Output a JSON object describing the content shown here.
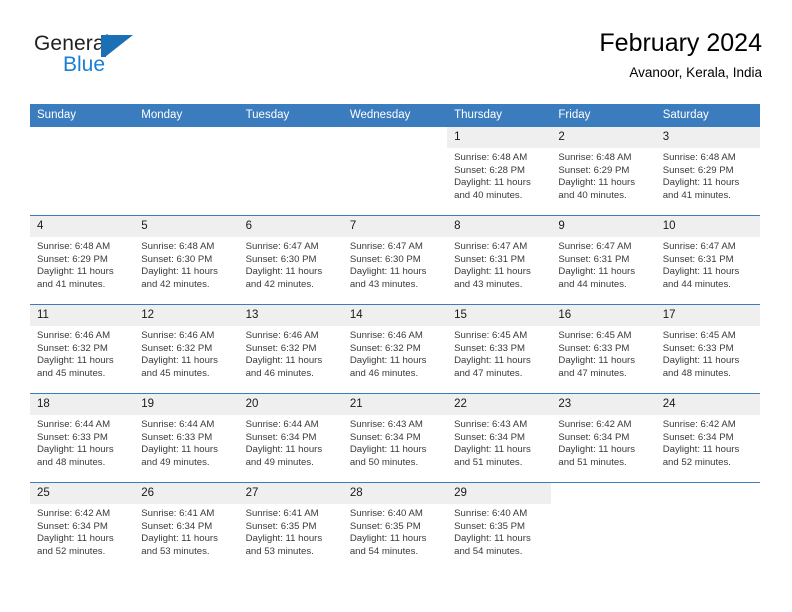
{
  "brand": {
    "name_top": "General",
    "name_bottom": "Blue",
    "mark": "triangle-logo"
  },
  "header": {
    "title": "February 2024",
    "subtitle": "Avanoor, Kerala, India"
  },
  "colors": {
    "header_blue": "#3a7cbe",
    "brand_blue": "#1a7fd4",
    "day_band": "#efefef"
  },
  "weekdays": [
    "Sunday",
    "Monday",
    "Tuesday",
    "Wednesday",
    "Thursday",
    "Friday",
    "Saturday"
  ],
  "weeks": [
    [
      {
        "day": "",
        "lines": [],
        "state": "blank"
      },
      {
        "day": "",
        "lines": [],
        "state": "blank"
      },
      {
        "day": "",
        "lines": [],
        "state": "blank"
      },
      {
        "day": "",
        "lines": [],
        "state": "blank"
      },
      {
        "day": "1",
        "lines": [
          "Sunrise: 6:48 AM",
          "Sunset: 6:28 PM",
          "Daylight: 11 hours",
          "and 40 minutes."
        ],
        "state": "filled"
      },
      {
        "day": "2",
        "lines": [
          "Sunrise: 6:48 AM",
          "Sunset: 6:29 PM",
          "Daylight: 11 hours",
          "and 40 minutes."
        ],
        "state": "filled"
      },
      {
        "day": "3",
        "lines": [
          "Sunrise: 6:48 AM",
          "Sunset: 6:29 PM",
          "Daylight: 11 hours",
          "and 41 minutes."
        ],
        "state": "filled"
      }
    ],
    [
      {
        "day": "4",
        "lines": [
          "Sunrise: 6:48 AM",
          "Sunset: 6:29 PM",
          "Daylight: 11 hours",
          "and 41 minutes."
        ],
        "state": "filled"
      },
      {
        "day": "5",
        "lines": [
          "Sunrise: 6:48 AM",
          "Sunset: 6:30 PM",
          "Daylight: 11 hours",
          "and 42 minutes."
        ],
        "state": "filled"
      },
      {
        "day": "6",
        "lines": [
          "Sunrise: 6:47 AM",
          "Sunset: 6:30 PM",
          "Daylight: 11 hours",
          "and 42 minutes."
        ],
        "state": "filled"
      },
      {
        "day": "7",
        "lines": [
          "Sunrise: 6:47 AM",
          "Sunset: 6:30 PM",
          "Daylight: 11 hours",
          "and 43 minutes."
        ],
        "state": "filled"
      },
      {
        "day": "8",
        "lines": [
          "Sunrise: 6:47 AM",
          "Sunset: 6:31 PM",
          "Daylight: 11 hours",
          "and 43 minutes."
        ],
        "state": "filled"
      },
      {
        "day": "9",
        "lines": [
          "Sunrise: 6:47 AM",
          "Sunset: 6:31 PM",
          "Daylight: 11 hours",
          "and 44 minutes."
        ],
        "state": "filled"
      },
      {
        "day": "10",
        "lines": [
          "Sunrise: 6:47 AM",
          "Sunset: 6:31 PM",
          "Daylight: 11 hours",
          "and 44 minutes."
        ],
        "state": "filled"
      }
    ],
    [
      {
        "day": "11",
        "lines": [
          "Sunrise: 6:46 AM",
          "Sunset: 6:32 PM",
          "Daylight: 11 hours",
          "and 45 minutes."
        ],
        "state": "filled"
      },
      {
        "day": "12",
        "lines": [
          "Sunrise: 6:46 AM",
          "Sunset: 6:32 PM",
          "Daylight: 11 hours",
          "and 45 minutes."
        ],
        "state": "filled"
      },
      {
        "day": "13",
        "lines": [
          "Sunrise: 6:46 AM",
          "Sunset: 6:32 PM",
          "Daylight: 11 hours",
          "and 46 minutes."
        ],
        "state": "filled"
      },
      {
        "day": "14",
        "lines": [
          "Sunrise: 6:46 AM",
          "Sunset: 6:32 PM",
          "Daylight: 11 hours",
          "and 46 minutes."
        ],
        "state": "filled"
      },
      {
        "day": "15",
        "lines": [
          "Sunrise: 6:45 AM",
          "Sunset: 6:33 PM",
          "Daylight: 11 hours",
          "and 47 minutes."
        ],
        "state": "filled"
      },
      {
        "day": "16",
        "lines": [
          "Sunrise: 6:45 AM",
          "Sunset: 6:33 PM",
          "Daylight: 11 hours",
          "and 47 minutes."
        ],
        "state": "filled"
      },
      {
        "day": "17",
        "lines": [
          "Sunrise: 6:45 AM",
          "Sunset: 6:33 PM",
          "Daylight: 11 hours",
          "and 48 minutes."
        ],
        "state": "filled"
      }
    ],
    [
      {
        "day": "18",
        "lines": [
          "Sunrise: 6:44 AM",
          "Sunset: 6:33 PM",
          "Daylight: 11 hours",
          "and 48 minutes."
        ],
        "state": "filled"
      },
      {
        "day": "19",
        "lines": [
          "Sunrise: 6:44 AM",
          "Sunset: 6:33 PM",
          "Daylight: 11 hours",
          "and 49 minutes."
        ],
        "state": "filled"
      },
      {
        "day": "20",
        "lines": [
          "Sunrise: 6:44 AM",
          "Sunset: 6:34 PM",
          "Daylight: 11 hours",
          "and 49 minutes."
        ],
        "state": "filled"
      },
      {
        "day": "21",
        "lines": [
          "Sunrise: 6:43 AM",
          "Sunset: 6:34 PM",
          "Daylight: 11 hours",
          "and 50 minutes."
        ],
        "state": "filled"
      },
      {
        "day": "22",
        "lines": [
          "Sunrise: 6:43 AM",
          "Sunset: 6:34 PM",
          "Daylight: 11 hours",
          "and 51 minutes."
        ],
        "state": "filled"
      },
      {
        "day": "23",
        "lines": [
          "Sunrise: 6:42 AM",
          "Sunset: 6:34 PM",
          "Daylight: 11 hours",
          "and 51 minutes."
        ],
        "state": "filled"
      },
      {
        "day": "24",
        "lines": [
          "Sunrise: 6:42 AM",
          "Sunset: 6:34 PM",
          "Daylight: 11 hours",
          "and 52 minutes."
        ],
        "state": "filled"
      }
    ],
    [
      {
        "day": "25",
        "lines": [
          "Sunrise: 6:42 AM",
          "Sunset: 6:34 PM",
          "Daylight: 11 hours",
          "and 52 minutes."
        ],
        "state": "filled"
      },
      {
        "day": "26",
        "lines": [
          "Sunrise: 6:41 AM",
          "Sunset: 6:34 PM",
          "Daylight: 11 hours",
          "and 53 minutes."
        ],
        "state": "filled"
      },
      {
        "day": "27",
        "lines": [
          "Sunrise: 6:41 AM",
          "Sunset: 6:35 PM",
          "Daylight: 11 hours",
          "and 53 minutes."
        ],
        "state": "filled"
      },
      {
        "day": "28",
        "lines": [
          "Sunrise: 6:40 AM",
          "Sunset: 6:35 PM",
          "Daylight: 11 hours",
          "and 54 minutes."
        ],
        "state": "filled"
      },
      {
        "day": "29",
        "lines": [
          "Sunrise: 6:40 AM",
          "Sunset: 6:35 PM",
          "Daylight: 11 hours",
          "and 54 minutes."
        ],
        "state": "filled"
      },
      {
        "day": "",
        "lines": [],
        "state": "blank"
      },
      {
        "day": "",
        "lines": [],
        "state": "blank"
      }
    ]
  ]
}
